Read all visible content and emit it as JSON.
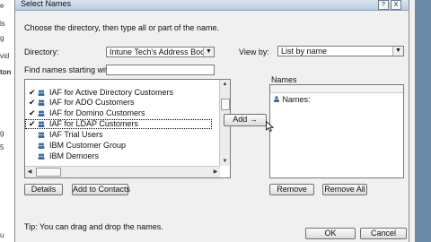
{
  "background": {
    "left_fragments": [
      "e",
      "ls",
      "g",
      "vid",
      "ton",
      "",
      "g",
      "5",
      "u"
    ]
  },
  "dialog": {
    "title": "Select Names",
    "help_button": "?",
    "close_button": "X",
    "instruction": "Choose the directory, then type all or part of the name.",
    "directory_label": "Directory:",
    "directory_value": "Intune Tech's Address Book",
    "view_by_label": "View by:",
    "view_by_value": "List by name",
    "find_label": "Find names starting with:",
    "find_value": "",
    "list_items": [
      {
        "label": "IAF for Active Directory Customers",
        "checked": true
      },
      {
        "label": "IAF for ADO Customers",
        "checked": true
      },
      {
        "label": "IAF for Domino Customers",
        "checked": true
      },
      {
        "label": "IAF for LDAP Customers",
        "checked": true
      },
      {
        "label": "IAF Trial Users",
        "checked": false
      },
      {
        "label": "IBM Customer Group",
        "checked": false
      },
      {
        "label": "IBM Demoers",
        "checked": false
      }
    ],
    "details_button": "Details",
    "add_to_contacts_button": "Add to Contacts",
    "add_button": "Add",
    "add_arrow": "→",
    "names_label": "Names",
    "names_header": "",
    "names_entries": [
      {
        "label": "Names:",
        "icon": "person-icon"
      }
    ],
    "remove_button": "Remove",
    "remove_all_button": "Remove All",
    "tip": "Tip: You can drag and drop the names.",
    "ok_button": "OK",
    "cancel_button": "Cancel"
  },
  "colors": {
    "selection_outline": "#000000",
    "titlebar": "#c8d8ea",
    "desktop": "#6c8aa8"
  }
}
